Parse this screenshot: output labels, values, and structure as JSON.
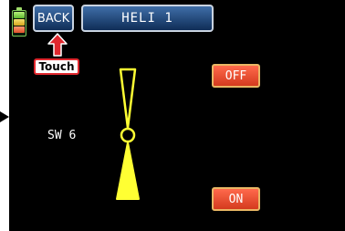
{
  "header": {
    "back_label": "BACK",
    "title": "HELI 1"
  },
  "annotation": {
    "touch_label": "Touch"
  },
  "switch": {
    "label": "SW 6",
    "off_label": "OFF",
    "on_label": "ON",
    "state": "ON"
  },
  "battery": {
    "segments": [
      "green",
      "yellow",
      "orange"
    ]
  },
  "colors": {
    "screen_bg": "#000000",
    "button_blue": "#1c4a85",
    "button_red": "#e8452a",
    "switch_yellow": "#ffff33",
    "annotation_red": "#e0282e"
  }
}
